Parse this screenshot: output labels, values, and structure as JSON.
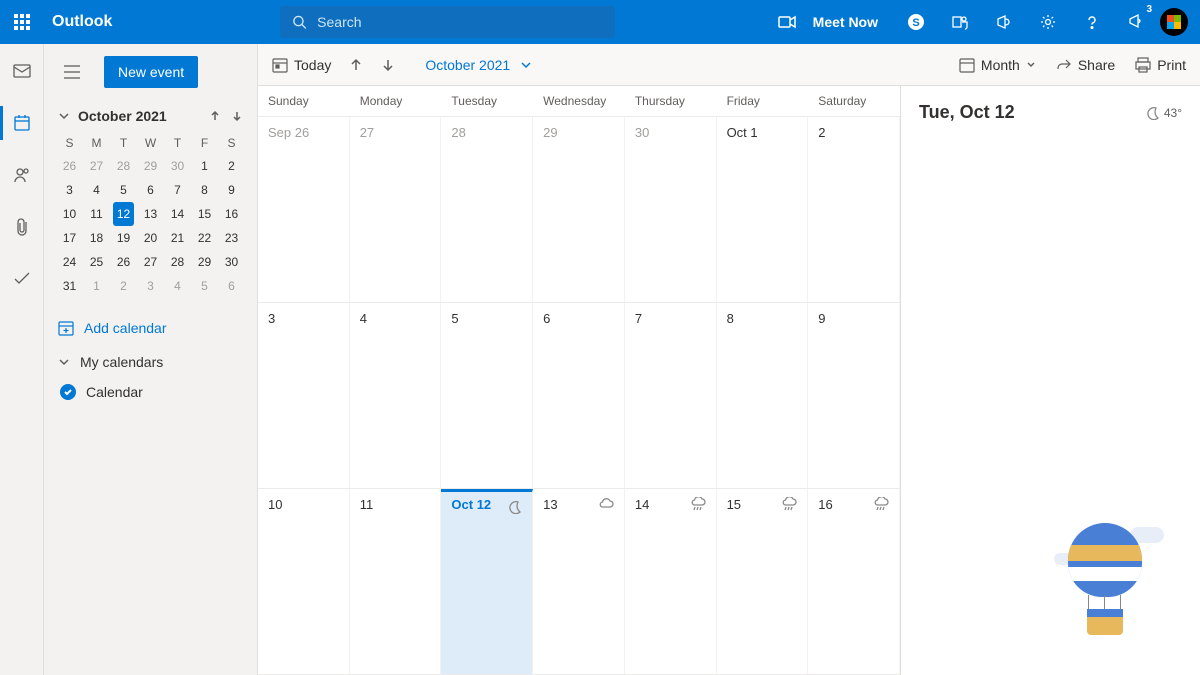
{
  "brand": "Outlook",
  "search": {
    "placeholder": "Search"
  },
  "meet_now": "Meet Now",
  "notification_count": "3",
  "new_event": "New event",
  "mini_cal": {
    "title": "October 2021",
    "dow": [
      "S",
      "M",
      "T",
      "W",
      "T",
      "F",
      "S"
    ],
    "days": [
      {
        "n": "26",
        "muted": true
      },
      {
        "n": "27",
        "muted": true
      },
      {
        "n": "28",
        "muted": true
      },
      {
        "n": "29",
        "muted": true
      },
      {
        "n": "30",
        "muted": true
      },
      {
        "n": "1"
      },
      {
        "n": "2"
      },
      {
        "n": "3"
      },
      {
        "n": "4"
      },
      {
        "n": "5"
      },
      {
        "n": "6"
      },
      {
        "n": "7"
      },
      {
        "n": "8"
      },
      {
        "n": "9"
      },
      {
        "n": "10"
      },
      {
        "n": "11"
      },
      {
        "n": "12",
        "today": true
      },
      {
        "n": "13"
      },
      {
        "n": "14"
      },
      {
        "n": "15"
      },
      {
        "n": "16"
      },
      {
        "n": "17"
      },
      {
        "n": "18"
      },
      {
        "n": "19"
      },
      {
        "n": "20"
      },
      {
        "n": "21"
      },
      {
        "n": "22"
      },
      {
        "n": "23"
      },
      {
        "n": "24"
      },
      {
        "n": "25"
      },
      {
        "n": "26"
      },
      {
        "n": "27"
      },
      {
        "n": "28"
      },
      {
        "n": "29"
      },
      {
        "n": "30"
      },
      {
        "n": "31"
      },
      {
        "n": "1",
        "muted": true
      },
      {
        "n": "2",
        "muted": true
      },
      {
        "n": "3",
        "muted": true
      },
      {
        "n": "4",
        "muted": true
      },
      {
        "n": "5",
        "muted": true
      },
      {
        "n": "6",
        "muted": true
      }
    ]
  },
  "add_calendar": "Add calendar",
  "my_calendars": "My calendars",
  "calendar_item": "Calendar",
  "toolbar": {
    "today": "Today",
    "month_label": "October 2021",
    "view": "Month",
    "share": "Share",
    "print": "Print"
  },
  "dow_full": [
    "Sunday",
    "Monday",
    "Tuesday",
    "Wednesday",
    "Thursday",
    "Friday",
    "Saturday"
  ],
  "weeks": [
    [
      {
        "n": "Sep 26",
        "muted": true
      },
      {
        "n": "27",
        "muted": true
      },
      {
        "n": "28",
        "muted": true
      },
      {
        "n": "29",
        "muted": true
      },
      {
        "n": "30",
        "muted": true
      },
      {
        "n": "Oct 1"
      },
      {
        "n": "2"
      }
    ],
    [
      {
        "n": "3"
      },
      {
        "n": "4"
      },
      {
        "n": "5"
      },
      {
        "n": "6"
      },
      {
        "n": "7"
      },
      {
        "n": "8"
      },
      {
        "n": "9"
      }
    ],
    [
      {
        "n": "10"
      },
      {
        "n": "11"
      },
      {
        "n": "Oct 12",
        "today": true,
        "weather": "moon"
      },
      {
        "n": "13",
        "weather": "cloud"
      },
      {
        "n": "14",
        "weather": "rain"
      },
      {
        "n": "15",
        "weather": "rain"
      },
      {
        "n": "16",
        "weather": "rain"
      }
    ]
  ],
  "panel": {
    "date": "Tue, Oct 12",
    "temp": "43°"
  }
}
